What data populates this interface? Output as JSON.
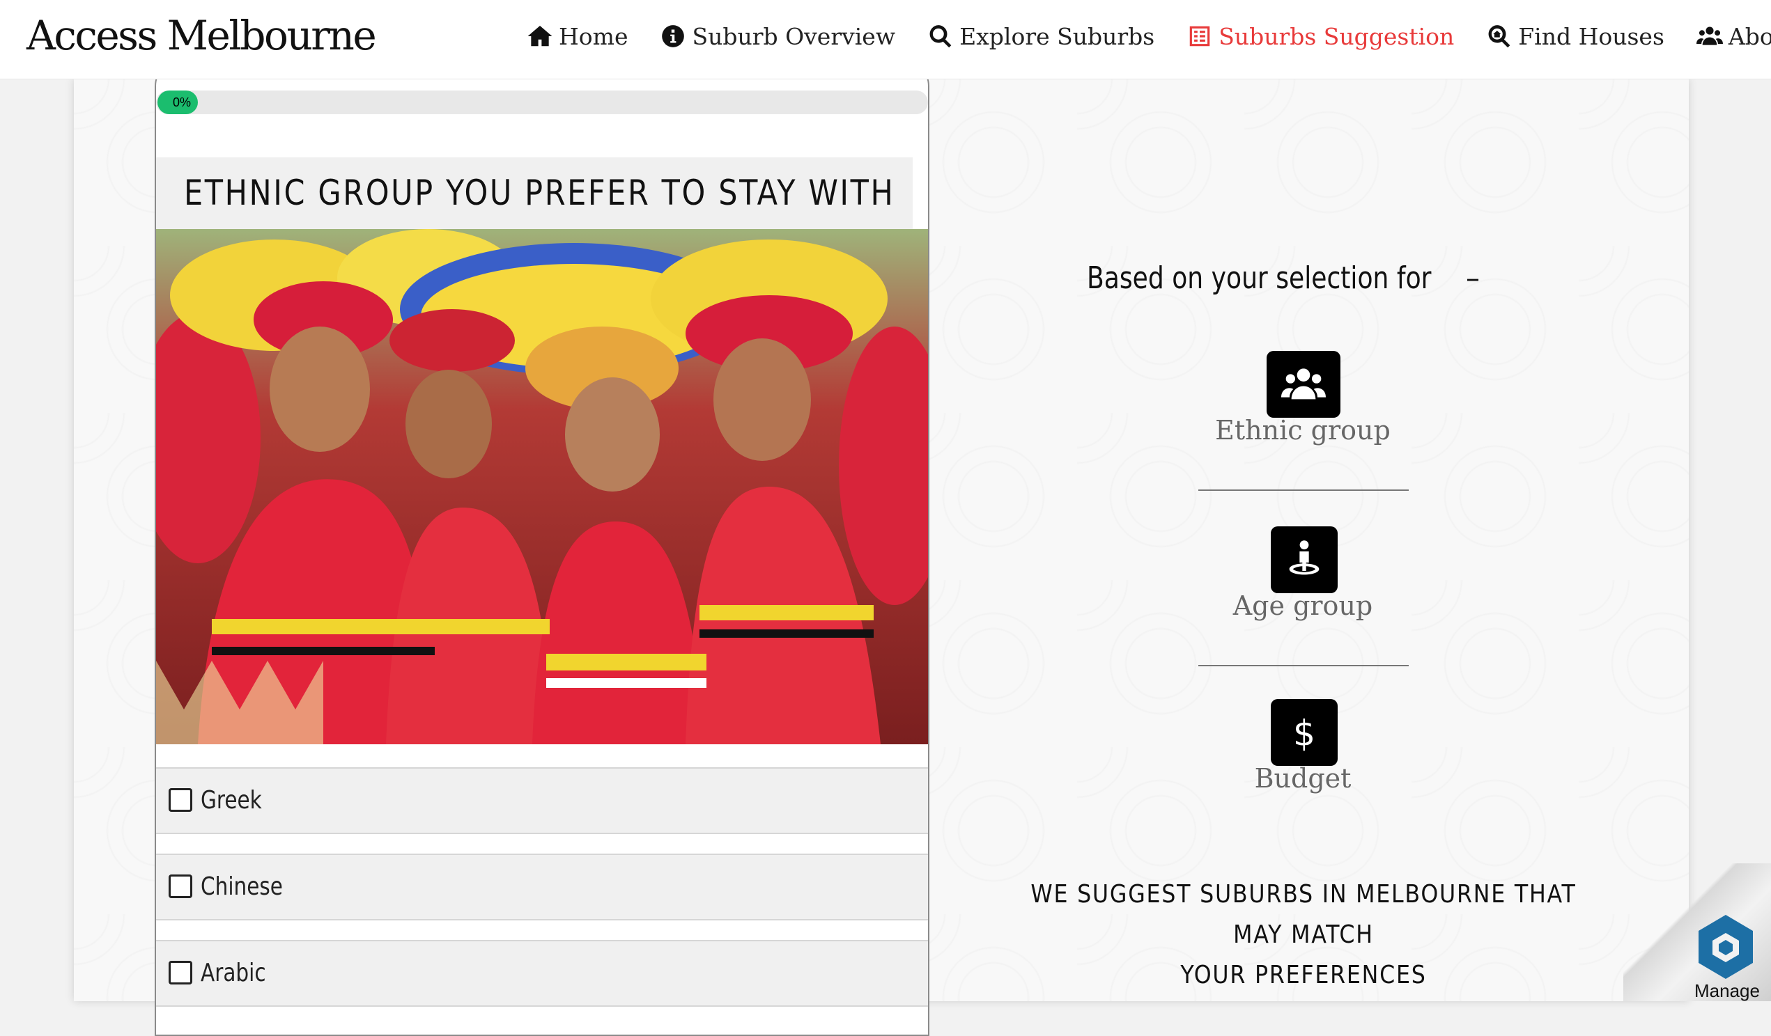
{
  "brand": {
    "name": "Access Melbourne"
  },
  "nav": {
    "items": [
      {
        "label": "Home",
        "icon": "home-icon"
      },
      {
        "label": "Suburb Overview",
        "icon": "info-icon"
      },
      {
        "label": "Explore Suburbs",
        "icon": "search-icon"
      },
      {
        "label": "Suburbs Suggestion",
        "icon": "checklist-icon",
        "active": true
      },
      {
        "label": "Find Houses",
        "icon": "search-house-icon"
      },
      {
        "label": "About Us",
        "icon": "users-icon"
      }
    ],
    "active_color": "#e83a3a"
  },
  "question": {
    "progress": {
      "percent": 0,
      "label": "0%",
      "color": "#1bbd6e"
    },
    "title": "ETHNIC GROUP YOU PREFER TO STAY WITH",
    "image_icon": "festival-photo",
    "options": [
      {
        "label": "Greek",
        "checked": false
      },
      {
        "label": "Chinese",
        "checked": false
      },
      {
        "label": "Arabic",
        "checked": false
      }
    ]
  },
  "summary": {
    "heading": "Based on your selection for",
    "dash": "–",
    "items": [
      {
        "label": "Ethnic group",
        "icon": "users-icon"
      },
      {
        "label": "Age group",
        "icon": "person-location-icon"
      },
      {
        "label": "Budget",
        "icon": "dollar-icon"
      }
    ],
    "suggestion_line1": "WE SUGGEST SUBURBS IN MELBOURNE THAT MAY MATCH",
    "suggestion_line2": "YOUR PREFERENCES"
  },
  "widget": {
    "label": "Manage",
    "color": "#1d6fa5"
  }
}
